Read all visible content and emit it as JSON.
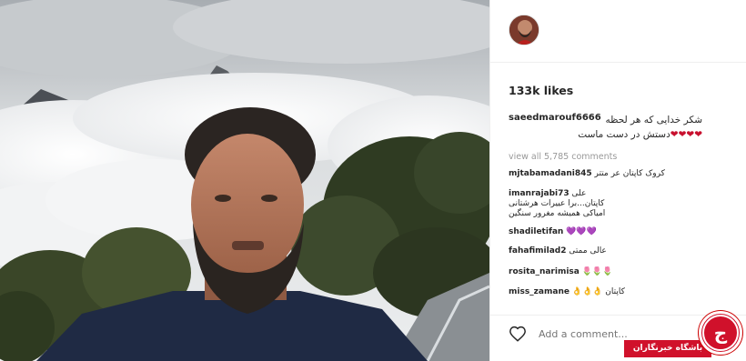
{
  "post": {
    "likes": "133k likes",
    "caption_user": "saeedmarouf6666",
    "caption_text": "شکر خدایی که هر لحظه",
    "caption_hearts": "❤❤❤❤",
    "caption_text2": "دستش در دست ماست",
    "view_all": "view all 5,785 comments"
  },
  "comments": [
    {
      "user": "mjtabamadani845",
      "text": "کروک کاپتان عر متتر"
    },
    {
      "user": "imanrajabi73",
      "text": "علی کاپتان...برا عییرات هرشتانی امیاکی همیشه مغرور سنگین"
    },
    {
      "user": "shadiletifan",
      "text": "💜💜💜"
    },
    {
      "user": "fahafimilad2",
      "text": "عالی ممتی"
    },
    {
      "user": "rosita_narimisa",
      "text": "🌷🌷🌷"
    },
    {
      "user": "miss_zamane",
      "text": "کاپتان 👌👌👌"
    }
  ],
  "add_comment_placeholder": "Add a comment...",
  "watermark": {
    "logo_letter": "ج",
    "label": "باشگاه خبرنگاران"
  },
  "colors": {
    "watermark_red": "#d0112b",
    "heart_red": "#c8102e"
  },
  "icons": {
    "like": "heart-outline-icon"
  }
}
